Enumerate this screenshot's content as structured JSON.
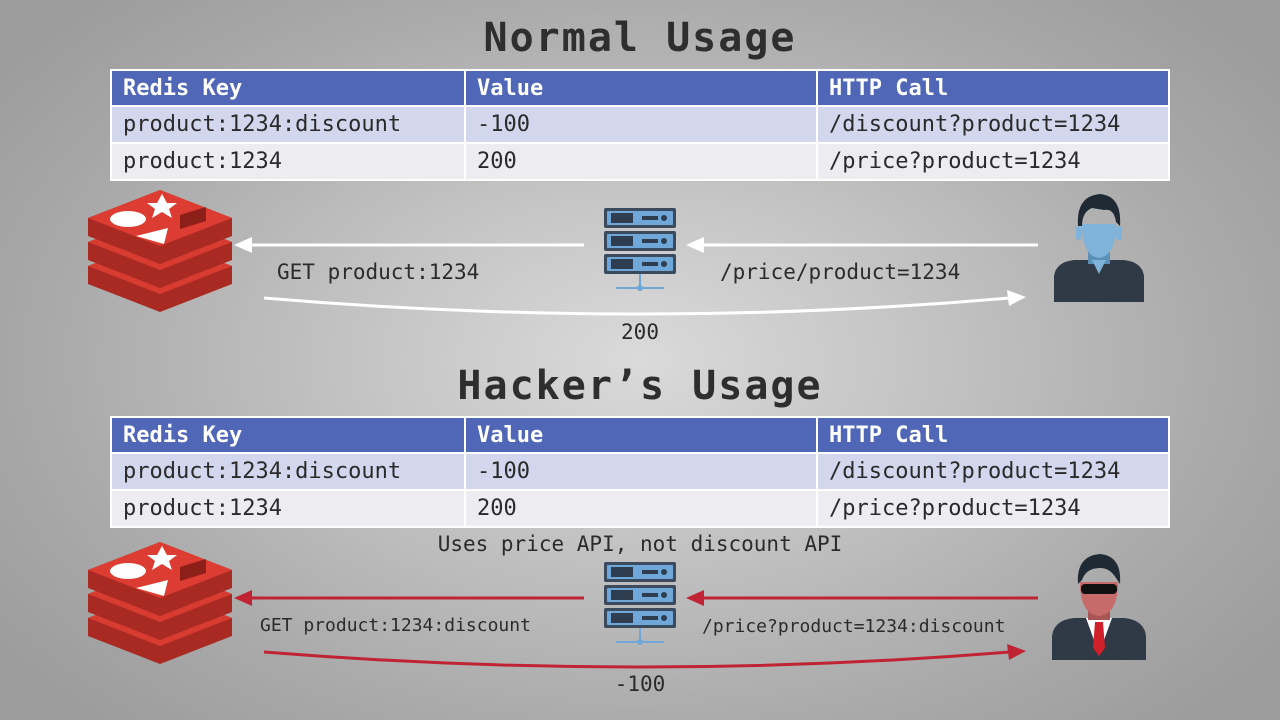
{
  "normal": {
    "title": "Normal Usage",
    "table": {
      "headers": [
        "Redis Key",
        "Value",
        "HTTP Call"
      ],
      "rows": [
        [
          "product:1234:discount",
          "-100",
          "/discount?product=1234"
        ],
        [
          "product:1234",
          "200",
          "/price?product=1234"
        ]
      ]
    },
    "flow": {
      "redis_request": "GET product:1234",
      "client_request": "/price/product=1234",
      "response": "200"
    }
  },
  "hacker": {
    "title": "Hacker’s Usage",
    "table": {
      "headers": [
        "Redis Key",
        "Value",
        "HTTP Call"
      ],
      "rows": [
        [
          "product:1234:discount",
          "-100",
          "/discount?product=1234"
        ],
        [
          "product:1234",
          "200",
          "/price?product=1234"
        ]
      ]
    },
    "note": "Uses price API, not discount API",
    "flow": {
      "redis_request": "GET product:1234:discount",
      "client_request": "/price?product=1234:discount",
      "response": "-100"
    }
  },
  "colors": {
    "header_blue": "#5067b7",
    "row_light": "#d3d7ee",
    "row_white": "#ececf1",
    "redis_red": "#d83b30",
    "server_blue": "#6fa8d8",
    "arrow_normal": "#ffffff",
    "arrow_hacker": "#c02434",
    "user_skin": "#7fb3d9",
    "hacker_skin": "#c76a6a"
  },
  "icons": [
    "redis-logo-icon",
    "server-icon",
    "user-icon",
    "hacker-icon"
  ]
}
